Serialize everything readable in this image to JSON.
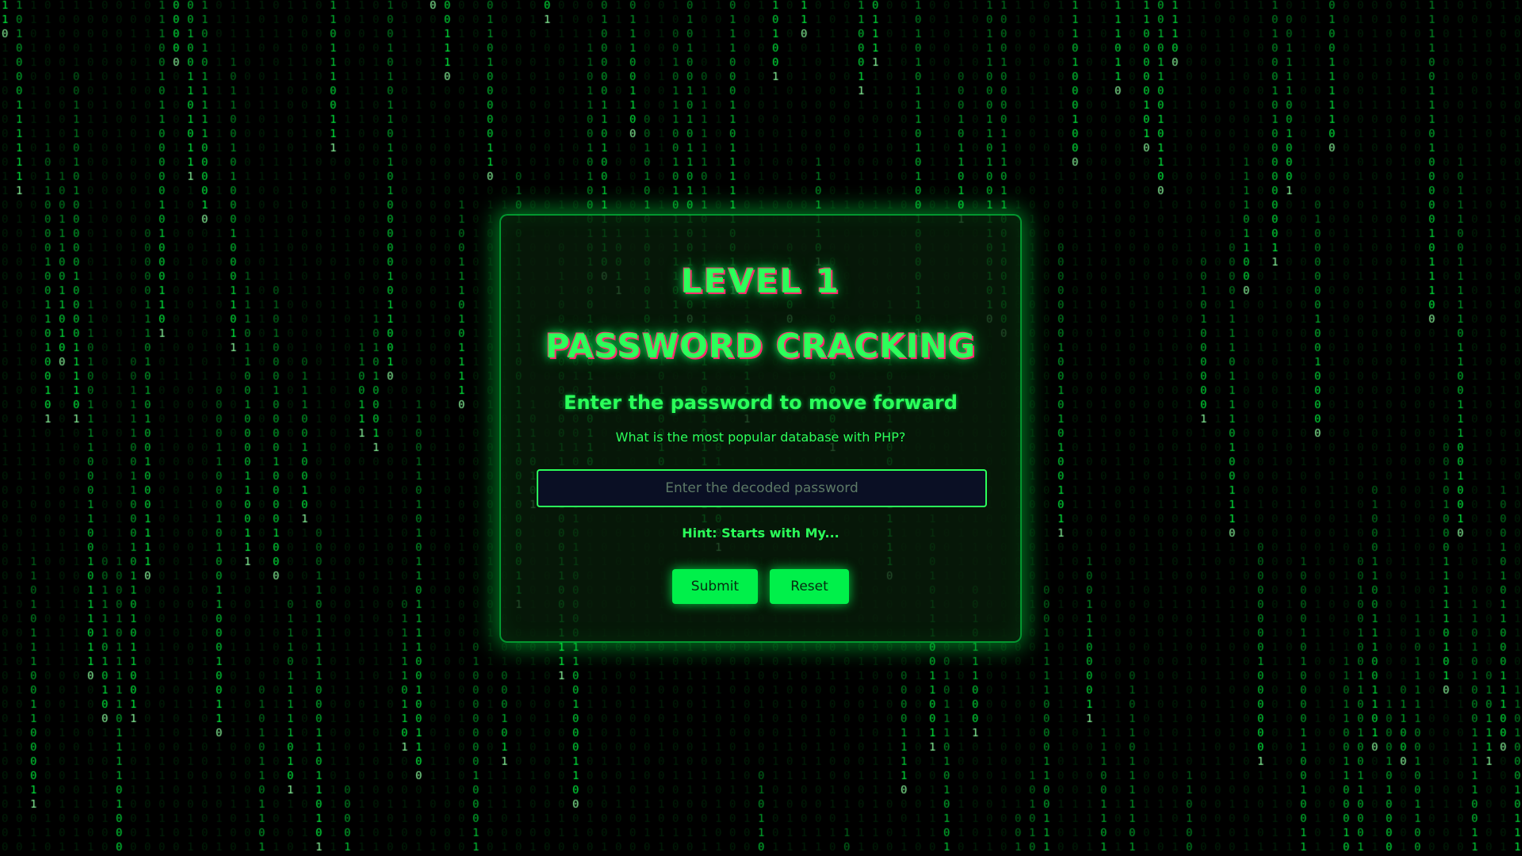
{
  "theme": {
    "background": "#000000",
    "matrix_green": "#00ff41",
    "accent_green": "#2bff5a",
    "accent_pink": "#ff2a6d",
    "input_background": "#0a0f24",
    "button_green": "#00f04a"
  },
  "card": {
    "level_title": "LEVEL 1",
    "title": "PASSWORD CRACKING",
    "subtitle": "Enter the password to move forward",
    "question": "What is the most popular database with PHP?",
    "password_placeholder": "Enter the decoded password",
    "password_value": "",
    "hint": "Hint: Starts with My...",
    "submit_label": "Submit",
    "reset_label": "Reset"
  }
}
